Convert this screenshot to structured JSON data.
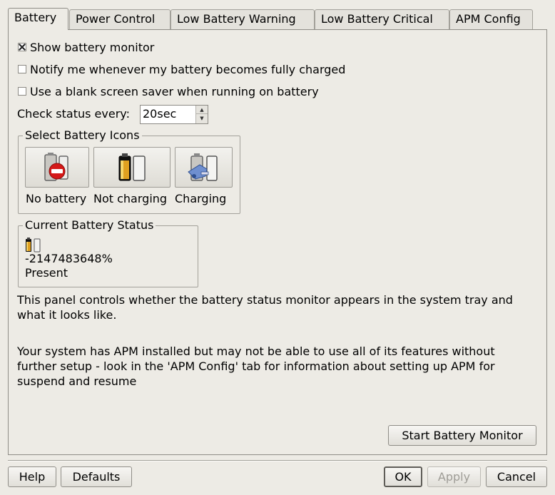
{
  "tabs": [
    {
      "label": "Battery",
      "active": true
    },
    {
      "label": "Power Control",
      "active": false
    },
    {
      "label": "Low Battery Warning",
      "active": false
    },
    {
      "label": "Low Battery Critical",
      "active": false
    },
    {
      "label": "APM Config",
      "active": false
    }
  ],
  "options": {
    "show_monitor": {
      "label": "Show battery monitor",
      "checked": true
    },
    "notify_full": {
      "label": "Notify me whenever my battery becomes fully charged",
      "checked": false
    },
    "blank_saver": {
      "label": "Use a blank screen saver when running on battery",
      "checked": false
    }
  },
  "check_status": {
    "label": "Check status every:",
    "value": "20sec"
  },
  "icons_group": {
    "title": "Select Battery Icons",
    "items": [
      {
        "label": "No battery",
        "icon": "no-battery-icon"
      },
      {
        "label": "Not charging",
        "icon": "not-charging-icon"
      },
      {
        "label": "Charging",
        "icon": "charging-icon"
      }
    ]
  },
  "status_group": {
    "title": "Current Battery Status",
    "percent": "-2147483648%",
    "state": "Present"
  },
  "description": {
    "line1": "This panel controls whether the battery status monitor appears in the system tray and",
    "line2": "what it looks like.",
    "line3": "Your system has APM installed but may not be able to use all of its features without",
    "line4": "further setup - look in the 'APM Config' tab for information about setting up APM for",
    "line5": "suspend and resume"
  },
  "start_button": "Start Battery Monitor",
  "buttons": {
    "help": "Help",
    "defaults": "Defaults",
    "ok": "OK",
    "apply": "Apply",
    "cancel": "Cancel"
  },
  "colors": {
    "background": "#edebe5",
    "battery_fill": "#e0a020",
    "no_battery_red": "#d41818",
    "charging_plug": "#6f8fcf"
  }
}
